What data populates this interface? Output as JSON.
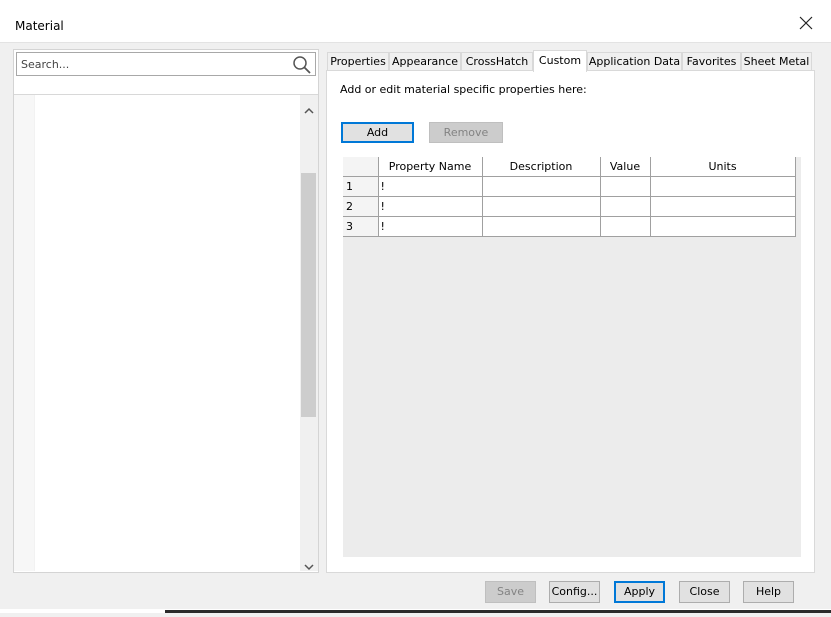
{
  "window": {
    "title": "Material",
    "close_icon": "close-icon"
  },
  "left_pane": {
    "search": {
      "placeholder": "Search...",
      "value": ""
    },
    "icons": {
      "search": "search-icon",
      "scroll_up": "chevron-up-icon",
      "scroll_down": "chevron-down-icon"
    }
  },
  "tabs": [
    {
      "label": "Properties",
      "active": false
    },
    {
      "label": "Appearance",
      "active": false
    },
    {
      "label": "CrossHatch",
      "active": false
    },
    {
      "label": "Custom",
      "active": true
    },
    {
      "label": "Application Data",
      "active": false
    },
    {
      "label": "Favorites",
      "active": false
    },
    {
      "label": "Sheet Metal",
      "active": false
    }
  ],
  "custom_tab": {
    "instruction": "Add or edit material specific properties here:",
    "add_label": "Add",
    "remove_label": "Remove",
    "table": {
      "columns": [
        "Property Name",
        "Description",
        "Value",
        "Units"
      ],
      "rows": [
        {
          "num": "1",
          "cells": [
            "!",
            "",
            "",
            ""
          ]
        },
        {
          "num": "2",
          "cells": [
            "!",
            "",
            "",
            ""
          ]
        },
        {
          "num": "3",
          "cells": [
            "!",
            "",
            "",
            ""
          ]
        }
      ]
    }
  },
  "footer": {
    "save_label": "Save",
    "config_label": "Config...",
    "apply_label": "Apply",
    "close_label": "Close",
    "help_label": "Help"
  },
  "colors": {
    "focus_blue": "#0078d7",
    "dialog_bg": "#f0f0f0",
    "disabled_bg": "#cccccc"
  }
}
